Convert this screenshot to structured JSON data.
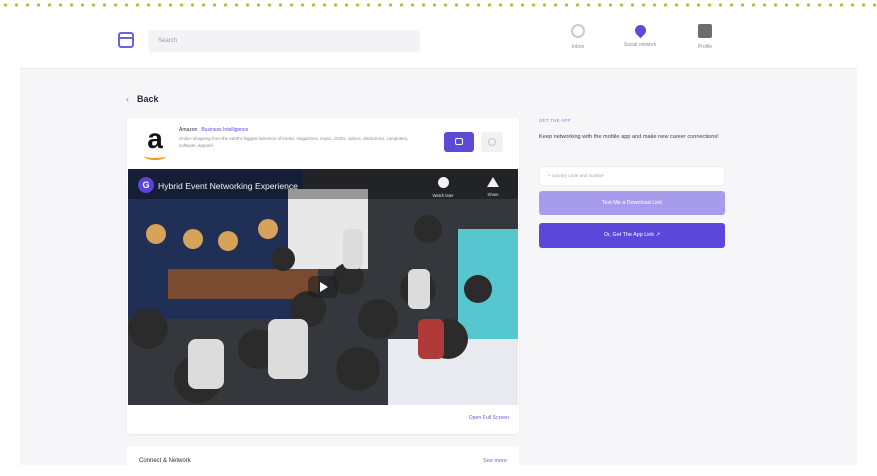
{
  "topbar": {
    "search_placeholder": "Search",
    "nav": [
      {
        "label": "Inbox",
        "icon": "chat-icon"
      },
      {
        "label": "Social network",
        "icon": "location-pin-icon"
      },
      {
        "label": "Profile",
        "icon": "profile-photo"
      }
    ],
    "accent": "#5b4bd6"
  },
  "page": {
    "back_label": "Back"
  },
  "company_card": {
    "name": "Amazon",
    "role": "Business Intelligence",
    "description": "Online shopping from the earth's biggest selection of books, magazines, music, DVDs, videos, electronics, computers, software, apparel.",
    "logo_letter": "a"
  },
  "video": {
    "channel_initial": "G",
    "title": "Hybrid Event Networking Experience",
    "watch_later_label": "Watch later",
    "share_label": "Share"
  },
  "open_fullscreen_label": "Open Full Screen",
  "next_card": {
    "title": "Connect & Network",
    "link": "See more"
  },
  "sidebar": {
    "section_title": "GET THE APP",
    "description": "Keep networking with the mobile app and make new career connections!",
    "phone_placeholder": "+ country code and number",
    "text_link_button": "Text Me a Download Link",
    "get_app_button": "Or, Get The App Link ↗"
  }
}
